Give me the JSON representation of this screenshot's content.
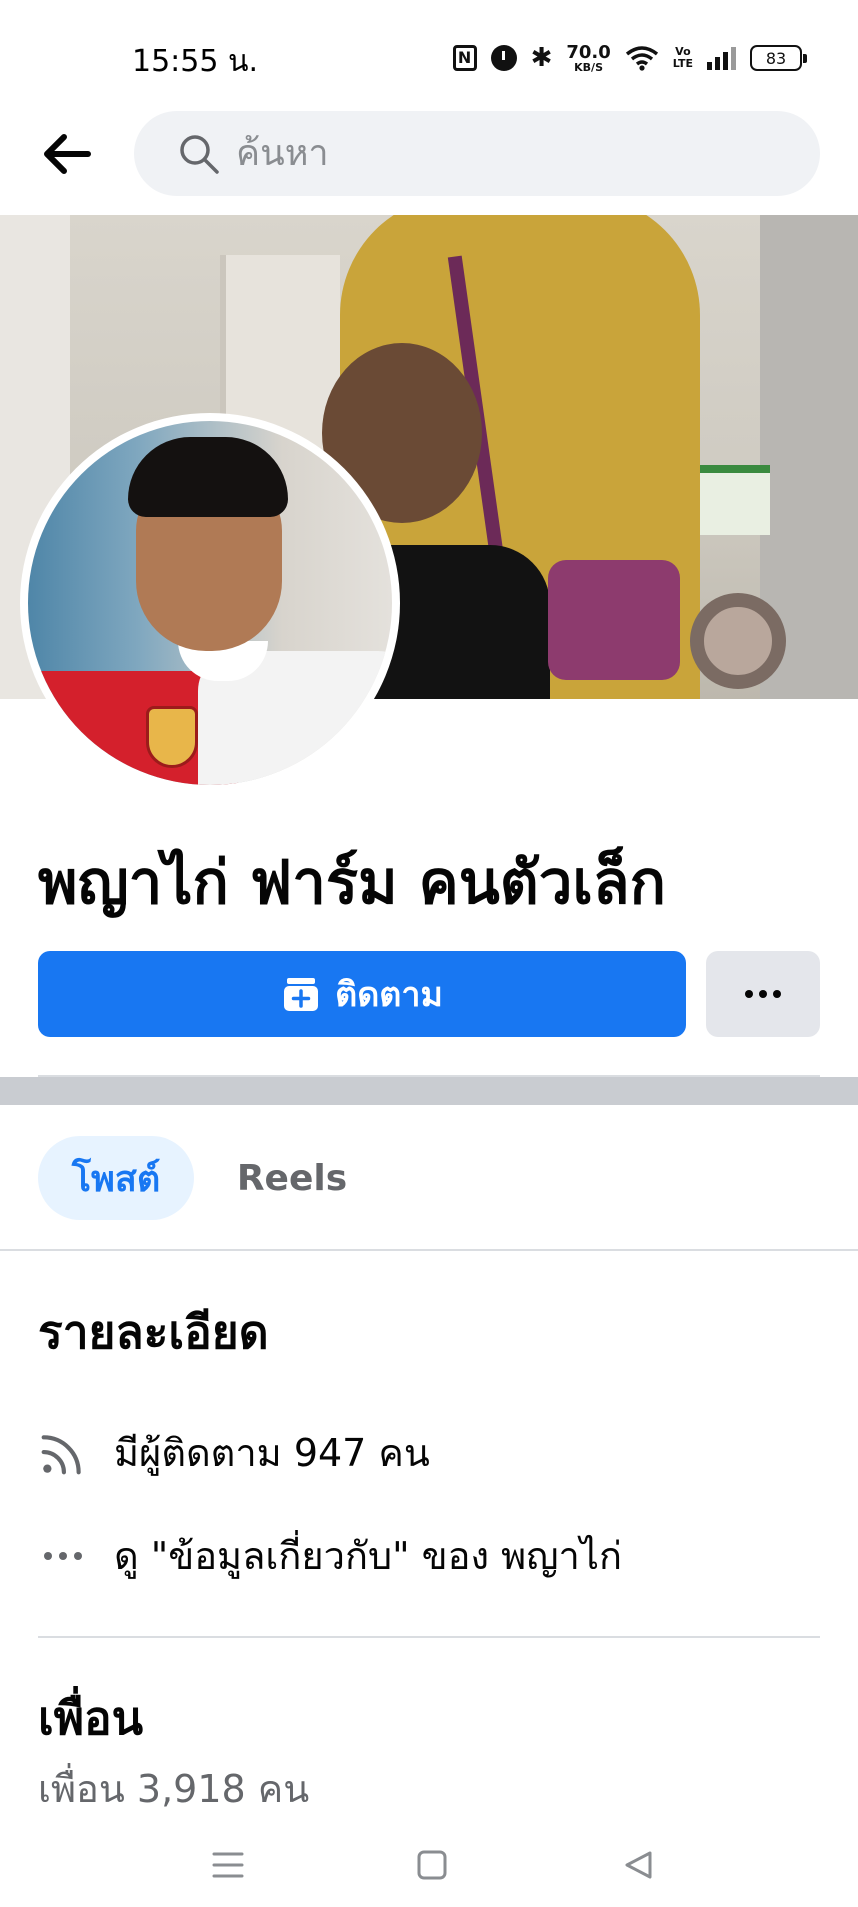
{
  "status_bar": {
    "time": "15:55 น.",
    "nfc_label": "N",
    "network_speed_value": "70.0",
    "network_speed_unit": "KB/S",
    "volte_top": "Vo",
    "volte_bottom": "LTE",
    "battery_level": "83",
    "icons": [
      "nfc-icon",
      "alarm-icon",
      "bluetooth-icon",
      "wifi-icon",
      "signal-icon",
      "battery-icon"
    ]
  },
  "header": {
    "back_icon": "arrow-left-icon",
    "search_placeholder": "ค้นหา"
  },
  "profile": {
    "name": "พญาไก่ ฟาร์ม คนตัวเล็ก",
    "follow_label": "ติดตาม",
    "more_icon": "ellipsis-icon"
  },
  "tabs": [
    {
      "label": "โพสต์",
      "active": true
    },
    {
      "label": "Reels",
      "active": false
    }
  ],
  "details": {
    "title": "รายละเอียด",
    "followers_text": "มีผู้ติดตาม 947 คน",
    "about_text": "ดู \"ข้อมูลเกี่ยวกับ\" ของ พญาไก่"
  },
  "friends": {
    "title": "เพื่อน",
    "count_text": "เพื่อน 3,918 คน"
  },
  "colors": {
    "primary": "#1877f2",
    "tab_active_bg": "#e7f3ff",
    "secondary_button": "#e4e6eb",
    "search_bg": "#f0f2f5",
    "muted_text": "#65676b"
  }
}
